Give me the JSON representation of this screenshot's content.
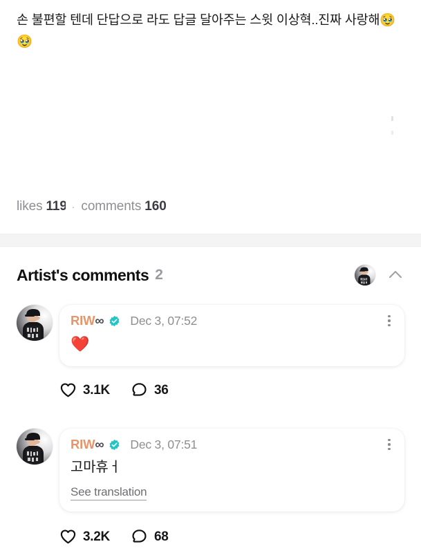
{
  "post": {
    "caption": "손 불편할 텐데 단답으로 라도 답글 달아주는 스윗 이상혁..진짜 사랑해",
    "caption_emoji": "🥹 🥹",
    "likes_label": "likes",
    "likes_value": "119",
    "separator_dot": "·",
    "comments_label": "comments",
    "comments_value": "160"
  },
  "artist_section": {
    "title": "Artist's comments",
    "count": "2",
    "collapse_icon": "chevron-up-icon",
    "avatar_icon": "artist-avatar"
  },
  "comments": [
    {
      "username_name": "RIW",
      "username_symbol": "∞",
      "verified": "verified-badge-icon",
      "timestamp": "Dec 3, 07:52",
      "body": "❤️",
      "body_is_emoji": true,
      "menu_icon": "kebab-menu-icon",
      "like_icon": "heart-outline-icon",
      "like_count": "3.1K",
      "reply_icon": "comment-bubble-icon",
      "reply_count": "36"
    },
    {
      "username_name": "RIW",
      "username_symbol": "∞",
      "verified": "verified-badge-icon",
      "timestamp": "Dec 3, 07:51",
      "body": "고마휴ㅓ",
      "body_is_emoji": false,
      "translation_label": "See translation",
      "menu_icon": "kebab-menu-icon",
      "like_icon": "heart-outline-icon",
      "like_count": "3.2K",
      "reply_icon": "comment-bubble-icon",
      "reply_count": "68"
    }
  ],
  "colors": {
    "username_accent": "#e8956a",
    "verified_badge": "#1ec6c6",
    "meta_text": "#8e8e93",
    "band": "#f4f4f5"
  }
}
